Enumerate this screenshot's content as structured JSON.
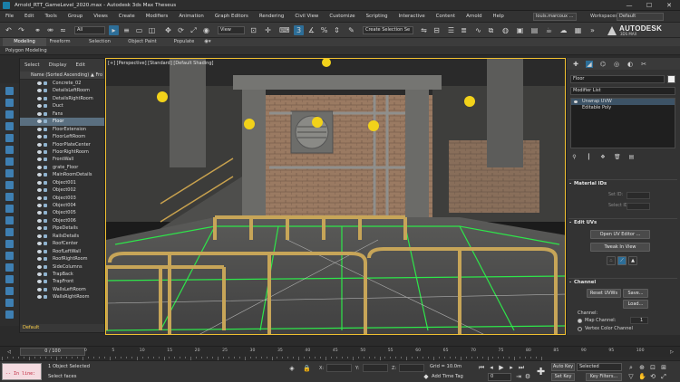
{
  "window": {
    "title": "Arnold_RTT_GameLevel_2020.max - Autodesk 3ds Max Theseus",
    "minimize_glyph": "—",
    "maximize_glyph": "☐",
    "close_glyph": "✕"
  },
  "menubar": {
    "items": [
      "File",
      "Edit",
      "Tools",
      "Group",
      "Views",
      "Create",
      "Modifiers",
      "Animation",
      "Graph Editors",
      "Rendering",
      "Civil View",
      "Customize",
      "Scripting",
      "Interactive",
      "Content",
      "Arnold",
      "Help"
    ],
    "user": "louis.marcoux ...",
    "workspaces_label": "Workspaces:",
    "workspace_value": "Default"
  },
  "toolbar": {
    "selection_filter": "All",
    "view_dropdown": "View",
    "snap_label": "3",
    "named_selection": "Create Selection Se",
    "brand": "AUTODESK",
    "brand_sub": "3DS MAX"
  },
  "ribbon": {
    "tabs": [
      "Modeling",
      "Freeform",
      "Selection",
      "Object Paint",
      "Populate"
    ],
    "subtab": "Polygon Modeling"
  },
  "explorer": {
    "menu": [
      "Select",
      "Display",
      "Edit"
    ],
    "column_header": "Name (Sorted Ascending)",
    "column_header_right": "▲ Fro",
    "items": [
      "Concrete_02",
      "DetailsLeftRoom",
      "DetailsRightRoom",
      "Duct",
      "Fans",
      "Floor",
      "FloorExtension",
      "FloorLeftRoom",
      "FloorPlateCenter",
      "FloorRightRoom",
      "FrontWall",
      "grate_Floor",
      "MainRoomDetails",
      "Object001",
      "Object002",
      "Object003",
      "Object004",
      "Object005",
      "Object006",
      "PipeDetails",
      "RailsDetails",
      "RoofCenter",
      "RoofLeftWall",
      "RoofRightRoom",
      "SideColumns",
      "TrapBack",
      "TrapFront",
      "WallsLeftRoom",
      "WallsRightRoom"
    ],
    "selected_index": 5,
    "footer": "Default"
  },
  "viewport": {
    "label": "[+] [Perspective] [Standard] [Default Shading]"
  },
  "command_panel": {
    "object_name": "Floor",
    "modifier_list": "Modifier List",
    "stack": [
      {
        "label": "Unwrap UVW",
        "selected": true
      },
      {
        "label": "Editable Poly",
        "selected": false
      }
    ],
    "rollouts": {
      "material_ids": "Material IDs",
      "set_id_label": "Set ID:",
      "select_id_label": "Select ID",
      "edit_uvs": "Edit UVs",
      "open_uv_editor": "Open UV Editor ...",
      "tweak_in_view": "Tweak In View",
      "channel": "Channel",
      "reset_uvws": "Reset UVWs",
      "save": "Save...",
      "load": "Load...",
      "channel_label": "Channel:",
      "map_channel": "Map Channel:",
      "map_channel_value": "1",
      "vertex_color_channel": "Vertex Color Channel"
    }
  },
  "timeline": {
    "frame_display": "0 / 100",
    "ticks": [
      "0",
      "5",
      "10",
      "15",
      "20",
      "25",
      "30",
      "35",
      "40",
      "45",
      "50",
      "55",
      "60",
      "65",
      "70",
      "75",
      "80",
      "85",
      "90",
      "95",
      "100"
    ]
  },
  "statusbar": {
    "maxscript_text": "-- In line:",
    "objects_selected": "1 Object Selected",
    "prompt": "Select faces",
    "x_label": "X:",
    "y_label": "Y:",
    "z_label": "Z:",
    "grid": "Grid = 10.0m",
    "add_time_tag": "Add Time Tag",
    "frame_value": "0",
    "auto_key": "Auto Key",
    "set_key": "Set Key",
    "selected_dropdown": "Selected",
    "key_filters": "Key Filters..."
  }
}
